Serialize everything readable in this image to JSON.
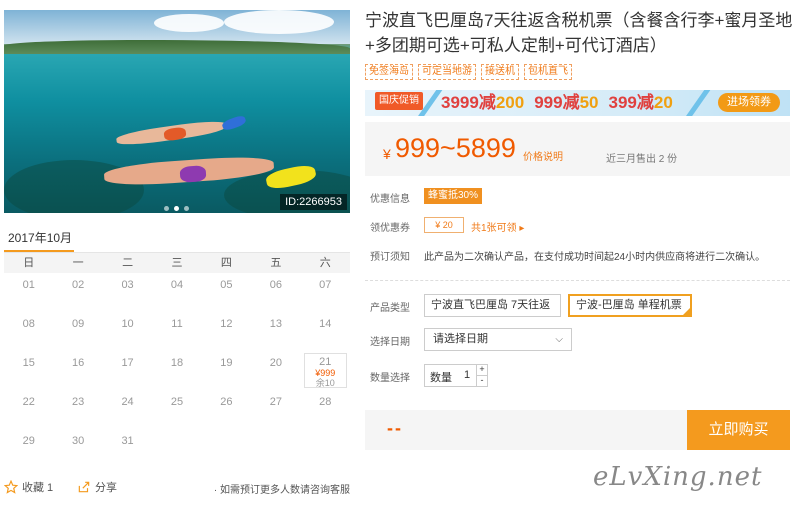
{
  "gallery": {
    "image_id": "ID:2266953",
    "dots": [
      false,
      true,
      false
    ]
  },
  "calendar": {
    "month_label": "2017年10月",
    "weekdays": [
      "日",
      "一",
      "二",
      "三",
      "四",
      "五",
      "六"
    ],
    "weeks": [
      [
        "01",
        "02",
        "03",
        "04",
        "05",
        "06",
        "07"
      ],
      [
        "08",
        "09",
        "10",
        "11",
        "12",
        "13",
        "14"
      ],
      [
        "15",
        "16",
        "17",
        "18",
        "19",
        "20",
        "21"
      ],
      [
        "22",
        "23",
        "24",
        "25",
        "26",
        "27",
        "28"
      ],
      [
        "29",
        "30",
        "31"
      ]
    ],
    "available": {
      "day": "21",
      "price": "¥999",
      "stock": "余10"
    }
  },
  "left_footer": {
    "favorite_label": "收藏 1",
    "share_label": "分享",
    "note": "· 如需预订更多人数请咨询客服"
  },
  "product": {
    "title": "宁波直飞巴厘岛7天往返含税机票（含餐含行李+蜜月圣地+多团期可选+可私人定制+可代订酒店）",
    "tags": [
      "免签海岛",
      "可定当地游",
      "接送机",
      "包机直飞"
    ]
  },
  "promo": {
    "ribbon": "国庆促销",
    "deals": [
      {
        "amount": "3999",
        "cut_label": "减",
        "cut": "200"
      },
      {
        "amount": "999",
        "cut_label": "减",
        "cut": "50"
      },
      {
        "amount": "399",
        "cut_label": "减",
        "cut": "20"
      }
    ],
    "cta": "进场领券"
  },
  "price": {
    "currency": "¥",
    "range": "999~5899",
    "explain_label": "价格说明",
    "sold": "近三月售出 2 份"
  },
  "info": {
    "offer_label": "优惠信息",
    "offer_badge": "蜂蜜抵30%",
    "coupon_label": "领优惠券",
    "coupon_value": "¥ 20",
    "coupon_link": "共1张可领 ▸",
    "notice_label": "预订须知",
    "notice_text": "此产品为二次确认产品，在支付成功时间起24小时内供应商将进行二次确认。"
  },
  "selection": {
    "type_label": "产品类型",
    "type_options": [
      "宁波直飞巴厘岛 7天往返",
      "宁波-巴厘岛 单程机票"
    ],
    "type_selected": 1,
    "date_label": "选择日期",
    "date_value": "请选择日期",
    "qty_label": "数量选择",
    "qty_inner_label": "数量",
    "qty_value": "1",
    "qty_plus": "+",
    "qty_minus": "-"
  },
  "buy": {
    "total": "--",
    "button": "立即购买"
  },
  "watermark": "eLvXing.net",
  "colors": {
    "accent": "#f49a1e",
    "price": "#f05a00",
    "promo_red": "#e0413f",
    "promo_orange": "#f0a010"
  }
}
